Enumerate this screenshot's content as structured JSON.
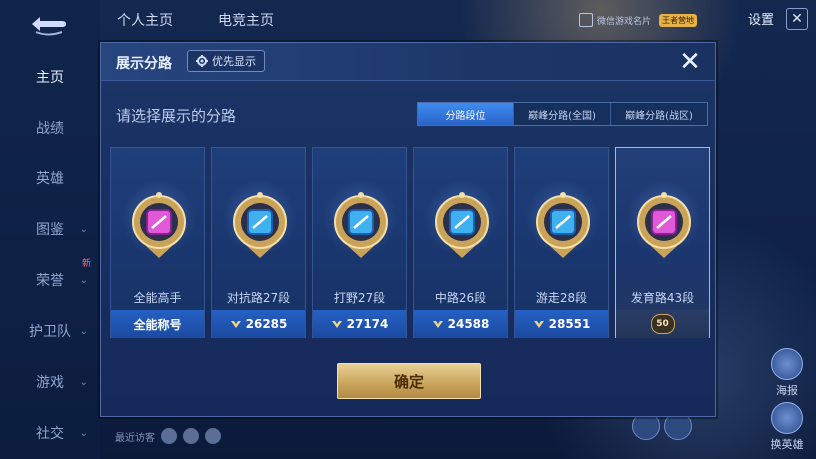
{
  "background": {
    "sidebar": [
      {
        "label": "主页",
        "active": true
      },
      {
        "label": "战绩"
      },
      {
        "label": "英雄"
      },
      {
        "label": "图鉴",
        "chevron": true
      },
      {
        "label": "荣誉",
        "chevron": true,
        "tag": "新"
      },
      {
        "label": "护卫队",
        "chevron": true
      },
      {
        "label": "游戏",
        "chevron": true
      },
      {
        "label": "社交",
        "chevron": true
      }
    ],
    "top_tabs": [
      "个人主页",
      "电竞主页"
    ],
    "card_text": "微信游戏名片",
    "vip_text": "王者营地",
    "settings": "设置",
    "right_buttons": [
      "海报",
      "换英雄"
    ],
    "visitors_label": "最近访客"
  },
  "modal": {
    "title": "展示分路",
    "priority_label": "优先显示",
    "subtitle": "请选择展示的分路",
    "segments": [
      "分路段位",
      "巅峰分路(全国)",
      "巅峰分路(战区)"
    ],
    "active_segment": 0,
    "cards": [
      {
        "name": "全能高手",
        "footer": "全能称号",
        "badge": "magenta",
        "selected": false
      },
      {
        "name": "对抗路27段",
        "footer": "26285",
        "badge": "blue",
        "selected": false
      },
      {
        "name": "打野27段",
        "footer": "27174",
        "badge": "blue",
        "selected": false
      },
      {
        "name": "中路26段",
        "footer": "24588",
        "badge": "blue",
        "selected": false
      },
      {
        "name": "游走28段",
        "footer": "28551",
        "badge": "blue",
        "selected": false
      },
      {
        "name": "发育路43段",
        "footer": "50",
        "badge": "magenta",
        "selected": true
      }
    ],
    "confirm_label": "确定"
  },
  "colors": {
    "accent_blue": "#2a64c8",
    "gold": "#c9a35a",
    "magenta": "#c03ad0"
  }
}
